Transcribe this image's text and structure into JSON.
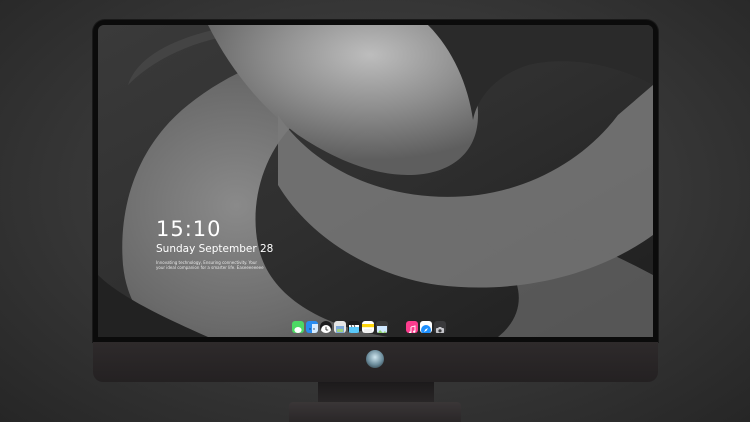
{
  "lock_screen": {
    "time": "15:10",
    "date": "Sunday September 28",
    "note_line1": "Innovating technology, Ensuring connectivity. Your",
    "note_line2": "your ideal companion for a smarter life. Easeeeeeeee"
  },
  "dock": {
    "apps": [
      {
        "icon": "messages-icon",
        "color": "#4cd964"
      },
      {
        "icon": "finder-icon",
        "color": "#2a8cf0"
      },
      {
        "icon": "clock-icon",
        "color": "#ffffff"
      },
      {
        "icon": "preview-icon",
        "color": "#7fa8d8"
      },
      {
        "icon": "final-cut-icon",
        "color": "#5ac8fa"
      },
      {
        "icon": "notes-icon",
        "color": "#ffd60a"
      },
      {
        "icon": "photos-icon",
        "color": "#8fcf6a"
      },
      {
        "icon": "music-icon",
        "color": "#fc3c8d"
      },
      {
        "icon": "safari-icon",
        "color": "#1e90ff"
      },
      {
        "icon": "camera-icon",
        "color": "#6e6e73"
      }
    ]
  },
  "colors": {
    "background": "#3a3a3a",
    "bezel": "#0b0b0b",
    "chin": "#2a2627",
    "text": "#ffffff"
  }
}
